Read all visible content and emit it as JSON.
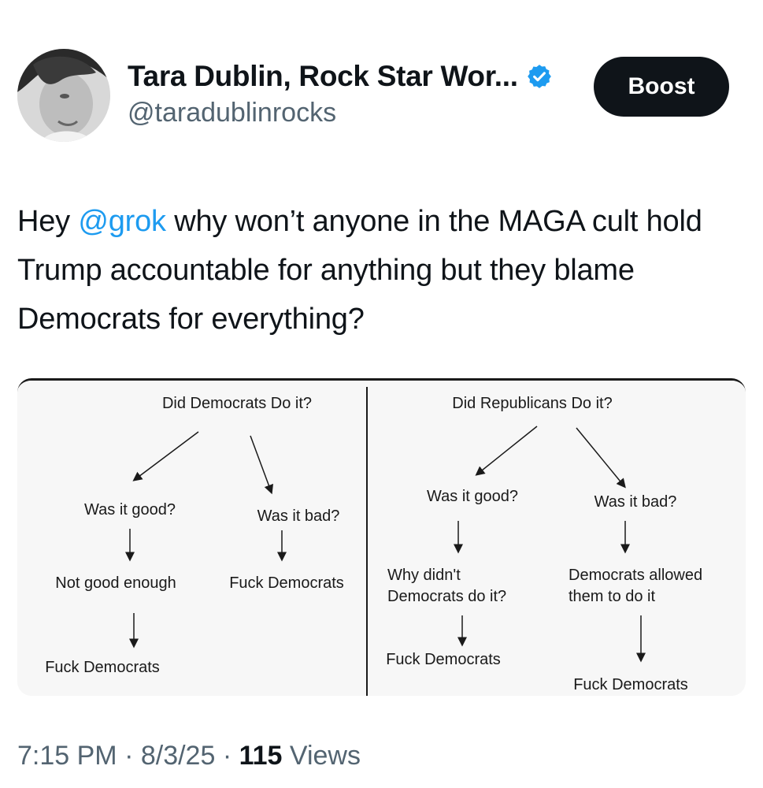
{
  "author": {
    "display_name": "Tara Dublin, Rock Star Wor...",
    "handle": "@taradublinrocks",
    "verified_icon": "verified-badge-icon",
    "accent_color": "#1d9bf0"
  },
  "actions": {
    "boost_label": "Boost"
  },
  "tweet": {
    "text_before": "Hey ",
    "mention": "@grok",
    "text_after": " why won’t anyone in the MAGA cult hold Trump accountable for anything but they blame Democrats for everything?"
  },
  "flowchart": {
    "left": {
      "title": "Did Democrats Do it?",
      "good": "Was it good?",
      "bad": "Was it bad?",
      "good_result": "Not good enough",
      "bad_result": "Fuck Democrats",
      "final": "Fuck Democrats"
    },
    "right": {
      "title": "Did Republicans Do it?",
      "good": "Was it good?",
      "bad": "Was it bad?",
      "good_result_line1": "Why didn't",
      "good_result_line2": "Democrats do it?",
      "bad_result_line1": "Democrats allowed",
      "bad_result_line2": "them to do it",
      "good_final": "Fuck Democrats",
      "bad_final": "Fuck Democrats"
    }
  },
  "footer": {
    "time": "7:15 PM",
    "sep1": " · ",
    "date": "8/3/25",
    "sep2": " · ",
    "views_count": "115",
    "views_label": " Views"
  }
}
